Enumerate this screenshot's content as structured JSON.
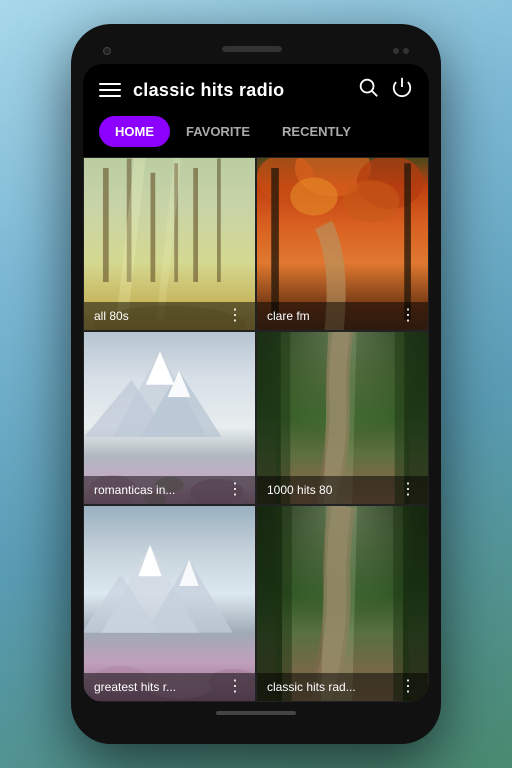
{
  "app": {
    "title": "classic hits radio"
  },
  "header": {
    "title": "classic hits radio",
    "search_label": "search",
    "power_label": "power"
  },
  "tabs": [
    {
      "id": "home",
      "label": "HOME",
      "active": true
    },
    {
      "id": "favorite",
      "label": "FAVORITE",
      "active": false
    },
    {
      "id": "recently",
      "label": "RECENTLY",
      "active": false
    }
  ],
  "grid_items": [
    {
      "id": "all-80s",
      "label": "all 80s",
      "image_type": "forest-spring"
    },
    {
      "id": "clare-fm",
      "label": "clare fm",
      "image_type": "autumn"
    },
    {
      "id": "romanticas-in",
      "label": "romanticas in...",
      "image_type": "mountain"
    },
    {
      "id": "1000-hits-80",
      "label": "1000 hits 80",
      "image_type": "forest-path"
    },
    {
      "id": "greatest-hits-r",
      "label": "greatest hits r...",
      "image_type": "mountain2"
    },
    {
      "id": "classic-hits-rad",
      "label": "classic hits rad...",
      "image_type": "forest-path2"
    }
  ],
  "icons": {
    "hamburger": "☰",
    "search": "⌕",
    "power": "⏻",
    "dots": "⋮"
  }
}
